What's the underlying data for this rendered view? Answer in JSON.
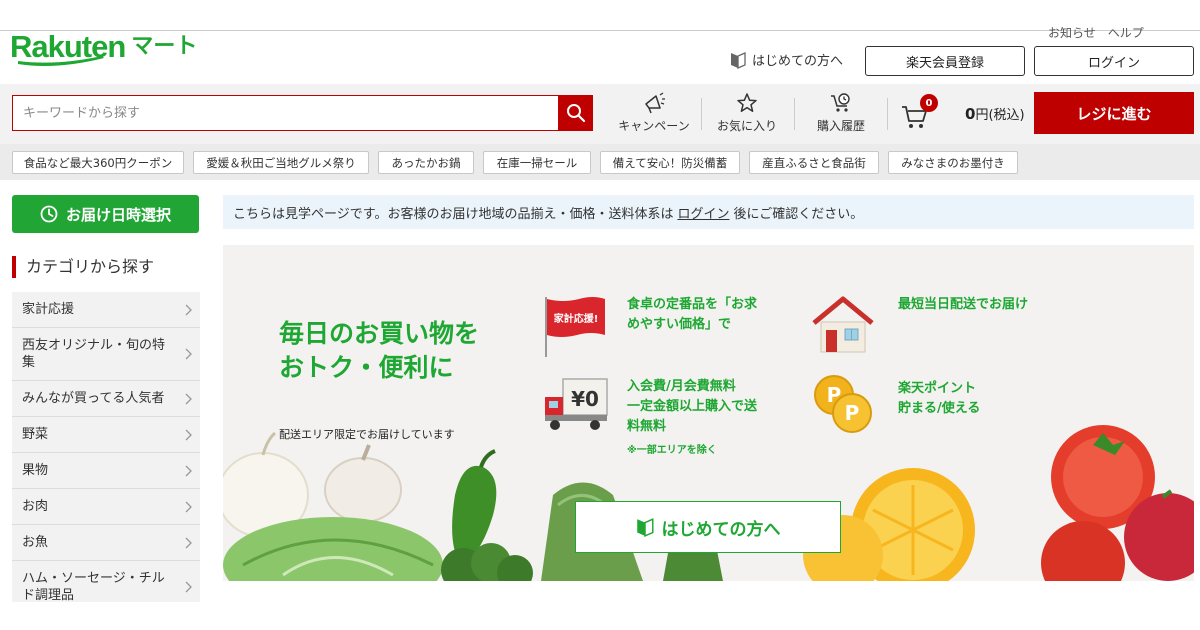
{
  "header": {
    "top_links_text": "お知らせ　ヘルプ",
    "logo_word": "Rakuten",
    "logo_suffix": "マート",
    "first_time_link": "はじめての方へ",
    "register_label": "楽天会員登録",
    "login_label": "ログイン"
  },
  "search": {
    "placeholder": "キーワードから探す"
  },
  "nav": {
    "campaign": "キャンペーン",
    "favorites": "お気に入り",
    "history": "購入履歴",
    "cart_count": "0",
    "cart_amount": "0",
    "cart_unit": "円(税込)",
    "checkout": "レジに進む"
  },
  "tags": [
    "食品など最大360円クーポン",
    "愛媛＆秋田ご当地グルメ祭り",
    "あったかお鍋",
    "在庫一掃セール",
    "備えて安心！防災備蓄",
    "産直ふるさと食品街",
    "みなさまのお墨付き"
  ],
  "sidebar": {
    "delivery_button": "お届け日時選択",
    "category_title": "カテゴリから探す",
    "categories": [
      "家計応援",
      "西友オリジナル・旬の特集",
      "みんなが買ってる人気者",
      "野菜",
      "果物",
      "お肉",
      "お魚",
      "ハム・ソーセージ・チルド調理品"
    ]
  },
  "notice": {
    "before": "こちらは見学ページです。お客様のお届け地域の品揃え・価格・送料体系は",
    "link": "ログイン",
    "after": "後にご確認ください。"
  },
  "hero": {
    "headline_line1": "毎日のお買い物を",
    "headline_line2": "おトク・便利に",
    "note": "配送エリア限定でお届けしています",
    "flag_text": "家計応援!",
    "truck_text": "¥0",
    "coin_text": "P",
    "features": [
      {
        "lines": [
          "食卓の定番品を「お求",
          "めやすい価格」で"
        ],
        "sub": "",
        "icon": "campaign-flag-icon"
      },
      {
        "lines": [
          "最短当日配送でお届け"
        ],
        "sub": "",
        "icon": "house-icon"
      },
      {
        "lines": [
          "入会費/月会費無料",
          "一定金額以上購入で送",
          "料無料"
        ],
        "sub": "※一部エリアを除く",
        "icon": "truck-icon"
      },
      {
        "lines": [
          "楽天ポイント",
          "貯まる/使える"
        ],
        "sub": "",
        "icon": "points-coin-icon"
      }
    ],
    "cta": "はじめての方へ"
  },
  "colors": {
    "brand_green": "#1ea732",
    "rakuten_red": "#bf0000",
    "notice_bg": "#eaf4fa"
  }
}
